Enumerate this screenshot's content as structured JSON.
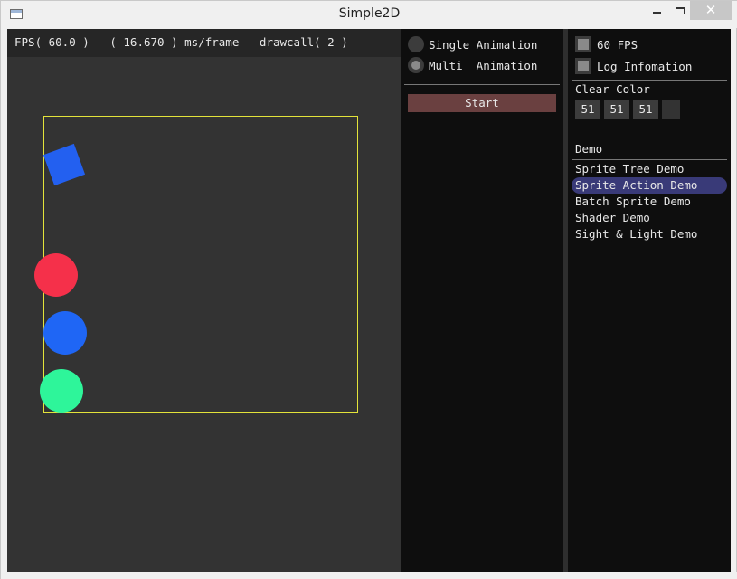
{
  "window": {
    "title": "Simple2D",
    "close_glyph": "✕"
  },
  "scene": {
    "fps_text": "FPS( 60.0 ) - ( 16.670 ) ms/frame - drawcall( 2 )"
  },
  "animation_panel": {
    "options": [
      {
        "label": "Single Animation",
        "selected": false
      },
      {
        "label": "Multi  Animation",
        "selected": true
      }
    ],
    "start_label": "Start"
  },
  "settings_panel": {
    "fps_label": "60 FPS",
    "log_label": "Log Infomation",
    "clear_color_label": "Clear Color",
    "clear_color": [
      "51",
      "51",
      "51"
    ],
    "demo_header": "Demo",
    "demos": [
      {
        "label": "Sprite Tree Demo",
        "selected": false
      },
      {
        "label": "Sprite Action Demo",
        "selected": true
      },
      {
        "label": "Batch Sprite Demo",
        "selected": false
      },
      {
        "label": "Shader Demo",
        "selected": false
      },
      {
        "label": "Sight & Light Demo",
        "selected": false
      }
    ]
  },
  "colors": {
    "clear_color_hex": "#333333",
    "selection": "#393a78",
    "start_button": "#6a4040",
    "bound_rect": "#e3e33a",
    "square_sprite": "#2360f0",
    "circle_red": "#f5304a",
    "circle_blue": "#1f66f5",
    "circle_green": "#2ef59a"
  }
}
